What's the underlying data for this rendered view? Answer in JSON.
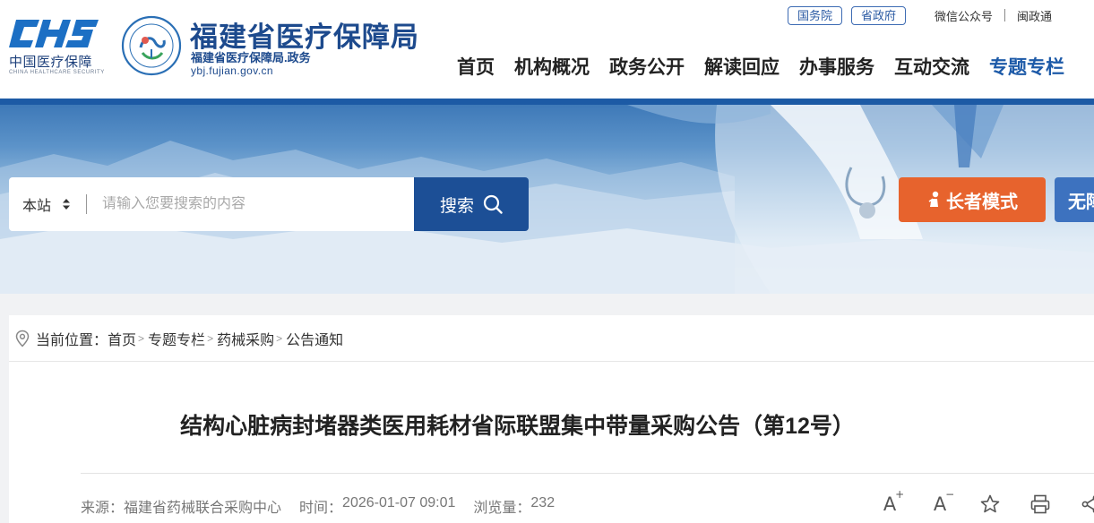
{
  "header": {
    "logo_mark": "CHS",
    "logo_cn": "中国医疗保障",
    "logo_en": "CHINA HEALTHCARE SECURITY",
    "seal_text": "福建医疗保障",
    "bureau_name": "福建省医疗保障局",
    "bureau_sub": "福建省医疗保障局.政务",
    "bureau_url": "ybj.fujian.gov.cn",
    "top_links": [
      "国务院",
      "省政府"
    ],
    "wechat": "微信公众号",
    "app": "闽政通"
  },
  "nav": {
    "items": [
      "首页",
      "机构概况",
      "政务公开",
      "解读回应",
      "办事服务",
      "互动交流",
      "专题专栏"
    ],
    "active_index": 6
  },
  "search": {
    "scope": "本站",
    "placeholder": "请输入您要搜索的内容",
    "button": "搜索"
  },
  "accessibility": {
    "elder_mode": "长者模式",
    "barrier_free": "无障碍"
  },
  "breadcrumb": {
    "label": "当前位置：",
    "items": [
      "首页",
      "专题专栏",
      "药械采购",
      "公告通知"
    ],
    "separator": ">"
  },
  "article": {
    "title": "结构心脏病封堵器类医用耗材省际联盟集中带量采购公告（第12号）",
    "source_label": "来源：",
    "source": "福建省药械联合采购中心",
    "time_label": "时间：",
    "time": "2026-01-07 09:01",
    "views_label": "浏览量：",
    "views": "232"
  },
  "tools": {
    "font_up": "A",
    "font_up_sign": "+",
    "font_down": "A",
    "font_down_sign": "−"
  },
  "colors": {
    "brand_blue": "#1d4a8d",
    "header_rule": "#1c5aa5",
    "search_button": "#1c4f96",
    "elder_button": "#e7632d",
    "barrier_button": "#3d72bf"
  }
}
